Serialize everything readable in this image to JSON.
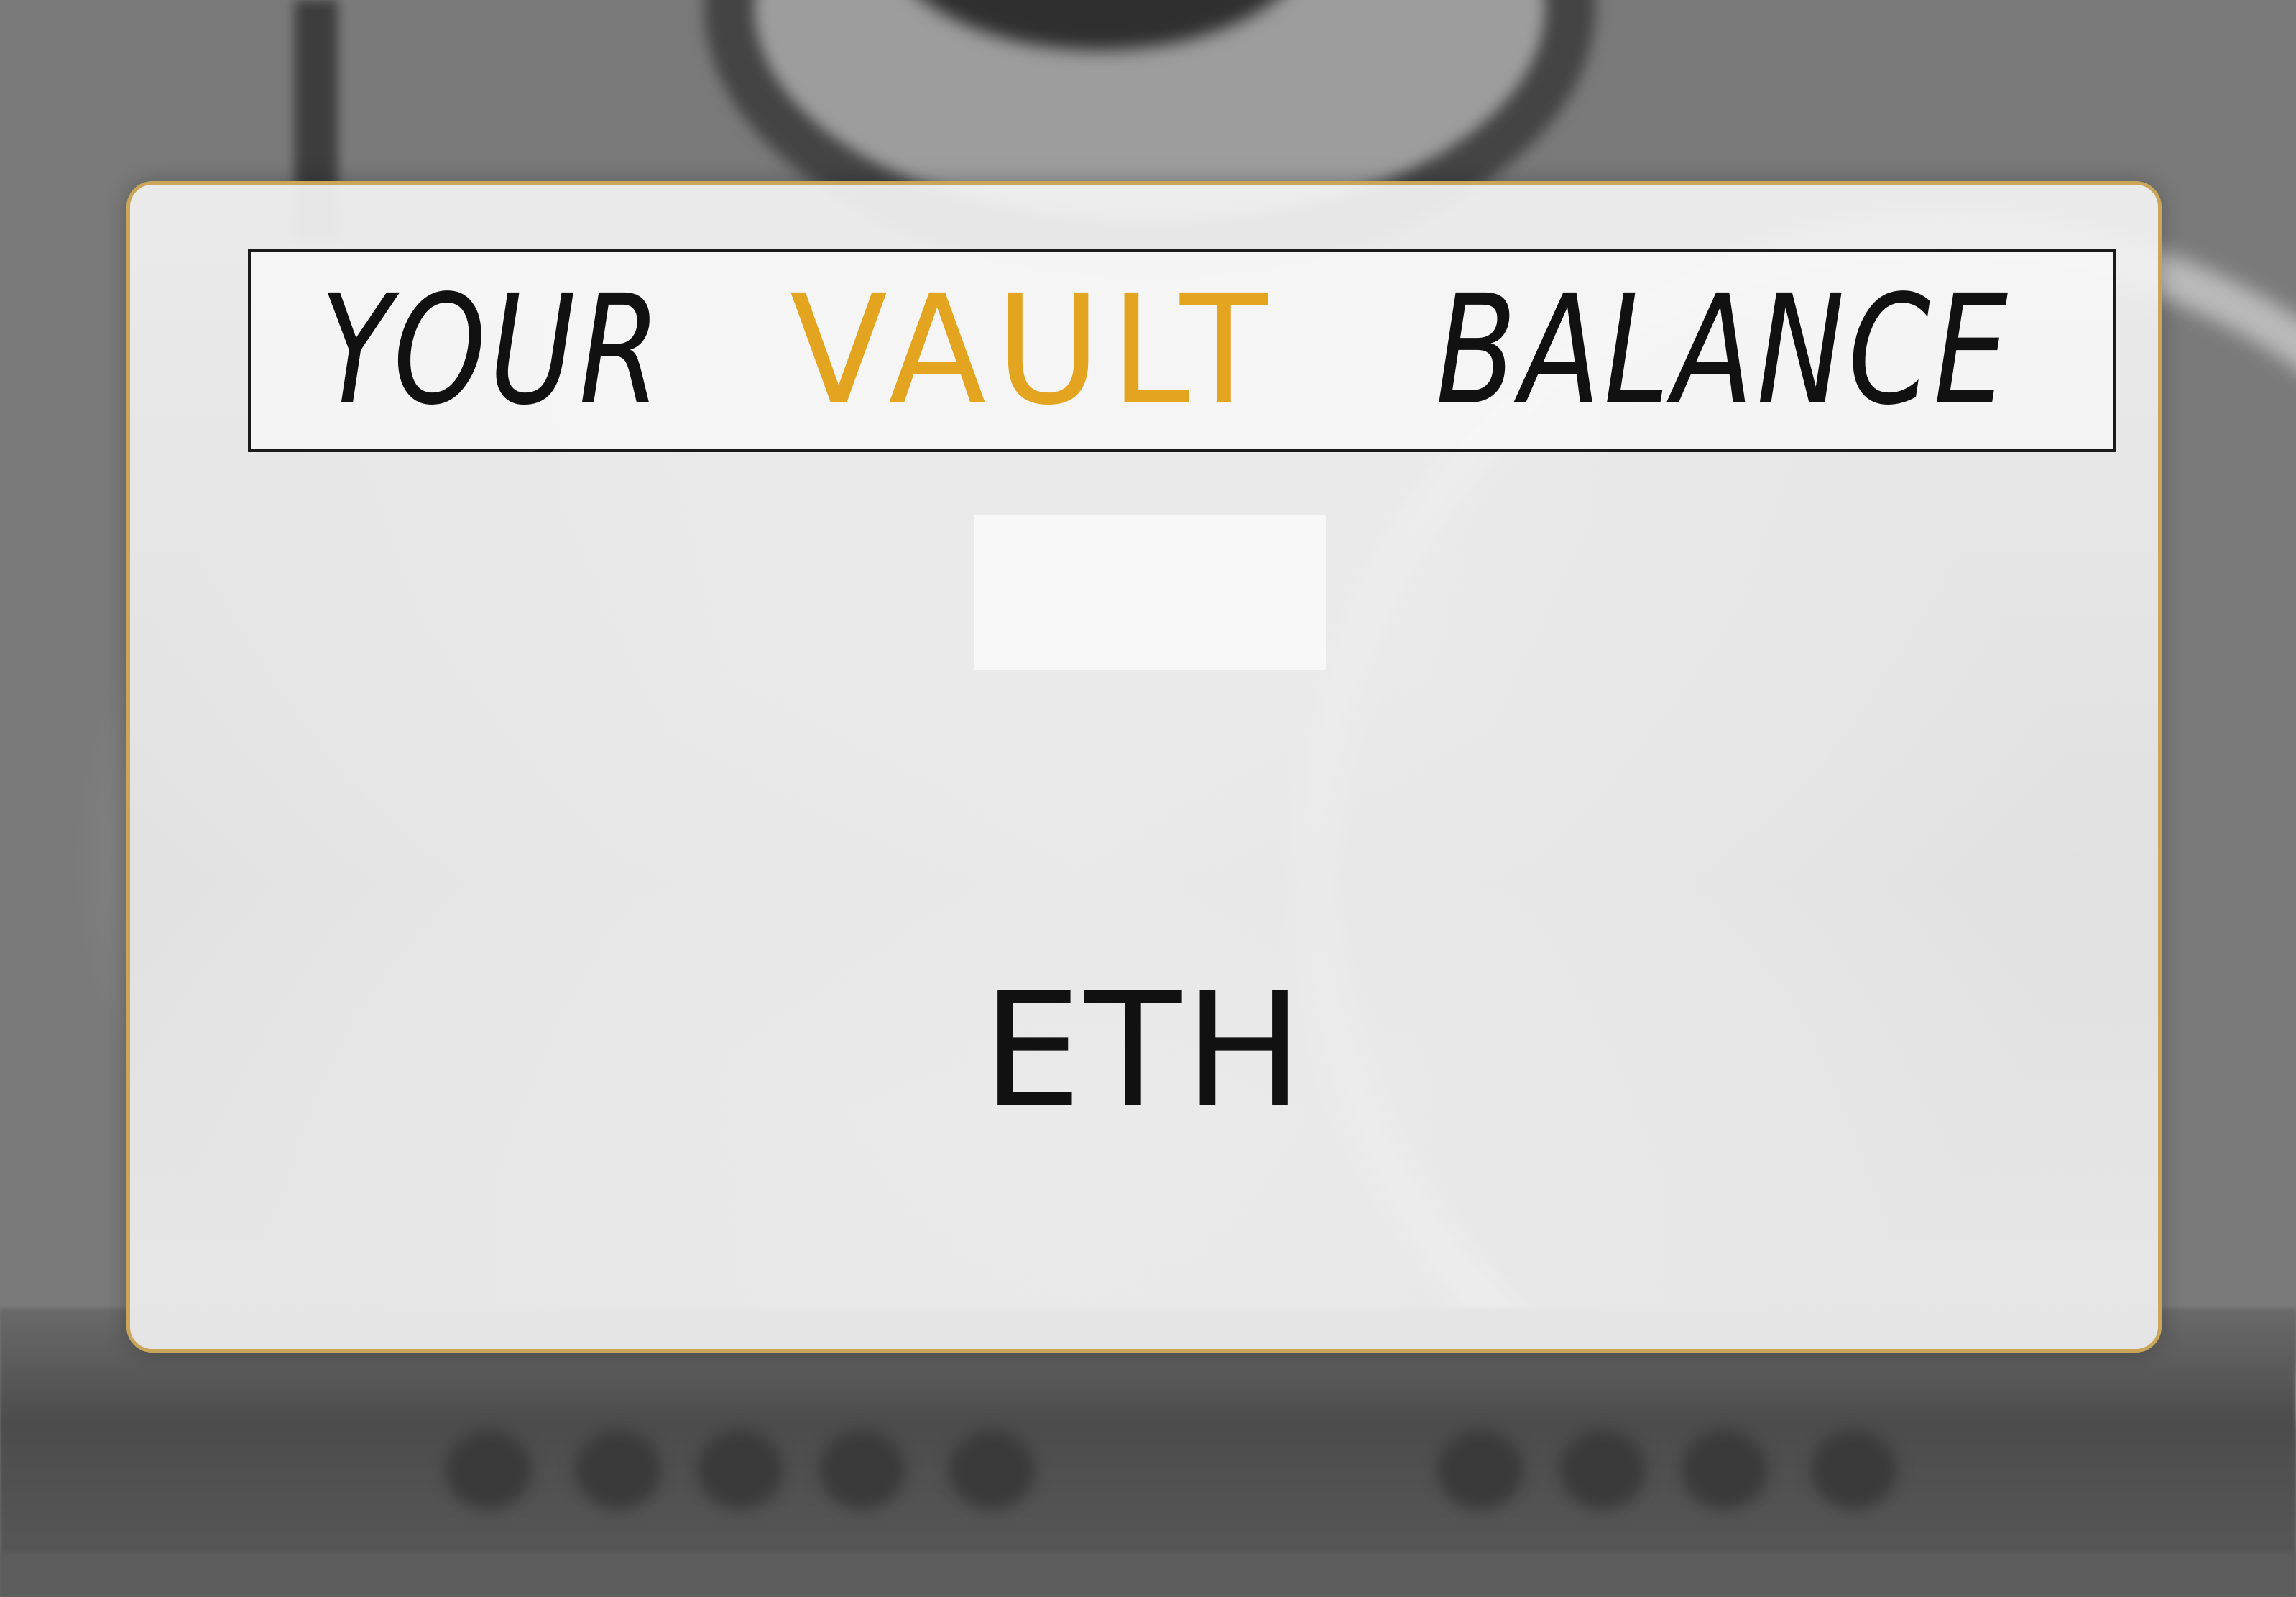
{
  "title": {
    "word1": "YOUR",
    "word2": "VAULT",
    "word3": "BALANCE"
  },
  "balance": {
    "value": "",
    "currency": "ETH"
  },
  "colors": {
    "accent": "#e3a420",
    "card_border": "#c9a65a",
    "text": "#111111"
  }
}
